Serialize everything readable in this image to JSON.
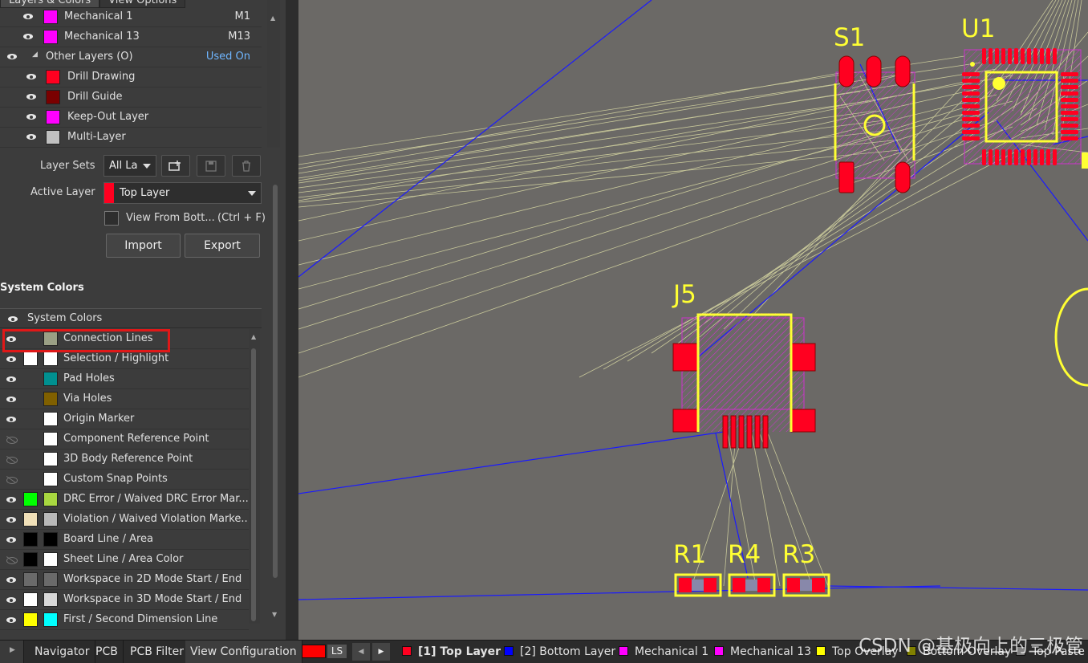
{
  "panel": {
    "tabs": [
      "Layers & Colors",
      "View Options"
    ],
    "layers": [
      {
        "name": "Mechanical 1",
        "short": "M1",
        "color": "#ff00ff"
      },
      {
        "name": "Mechanical 13",
        "short": "M13",
        "color": "#ff00ff"
      }
    ],
    "other_layers": {
      "label": "Other Layers (O)",
      "used_on": "Used On"
    },
    "other_items": [
      {
        "name": "Drill Drawing",
        "color": "#ff0020"
      },
      {
        "name": "Drill Guide",
        "color": "#7a0000"
      },
      {
        "name": "Keep-Out Layer",
        "color": "#ff00ff"
      },
      {
        "name": "Multi-Layer",
        "color": "#c0c0c0"
      }
    ],
    "layer_sets_label": "Layer Sets",
    "layer_sets_value": "All La",
    "active_layer_label": "Active Layer",
    "active_layer_value": "Top Layer",
    "view_from_bottom": "View From Bott...",
    "view_from_bottom_shortcut": "(Ctrl + F)",
    "import_label": "Import",
    "export_label": "Export"
  },
  "system_colors": {
    "section_title": "System Colors",
    "header_label": "System Colors",
    "rows": [
      {
        "name": "Connection Lines",
        "visible": true,
        "show_sel": false,
        "sel_color": "",
        "color": "#9ba085"
      },
      {
        "name": "Selection / Highlight",
        "visible": true,
        "show_sel": true,
        "sel_color": "#ffffff",
        "color": "#ffffff"
      },
      {
        "name": "Pad Holes",
        "visible": true,
        "show_sel": false,
        "sel_color": "",
        "color": "#009090"
      },
      {
        "name": "Via Holes",
        "visible": true,
        "show_sel": false,
        "sel_color": "",
        "color": "#806000"
      },
      {
        "name": "Origin Marker",
        "visible": true,
        "show_sel": false,
        "sel_color": "",
        "color": "#ffffff"
      },
      {
        "name": "Component Reference Point",
        "visible": false,
        "show_sel": false,
        "sel_color": "",
        "color": "#ffffff"
      },
      {
        "name": "3D Body Reference Point",
        "visible": false,
        "show_sel": false,
        "sel_color": "",
        "color": "#ffffff"
      },
      {
        "name": "Custom Snap Points",
        "visible": false,
        "show_sel": false,
        "sel_color": "",
        "color": "#ffffff"
      },
      {
        "name": "DRC Error / Waived DRC Error Mar...",
        "visible": true,
        "show_sel": true,
        "sel_color": "#00ff00",
        "color": "#a8d840"
      },
      {
        "name": "Violation / Waived Violation Marke...",
        "visible": true,
        "show_sel": true,
        "sel_color": "#f0e0b8",
        "color": "#b8b8b8"
      },
      {
        "name": "Board Line / Area",
        "visible": true,
        "show_sel": true,
        "sel_color": "#000000",
        "color": "#000000"
      },
      {
        "name": "Sheet Line / Area Color",
        "visible": false,
        "show_sel": true,
        "sel_color": "#000000",
        "color": "#ffffff"
      },
      {
        "name": "Workspace in 2D Mode Start / End",
        "visible": true,
        "show_sel": true,
        "sel_color": "#6a6a6a",
        "color": "#6a6a6a"
      },
      {
        "name": "Workspace in 3D Mode Start / End",
        "visible": true,
        "show_sel": true,
        "sel_color": "#ffffff",
        "color": "#d8d8d8"
      },
      {
        "name": "First / Second Dimension Line",
        "visible": true,
        "show_sel": true,
        "sel_color": "#ffff00",
        "color": "#00ffff"
      }
    ]
  },
  "pcb": {
    "designators": [
      "S1",
      "U1",
      "J5",
      "R1",
      "R4",
      "R3"
    ],
    "colors": {
      "background": "#6b6966",
      "pad": "#ff0020",
      "overlay": "#ffff33",
      "mech": "#cc33cc",
      "connection": "#b8b890",
      "trace_blue": "#1a1aff"
    }
  },
  "bottom_bar": {
    "panel_tabs": [
      "Navigator",
      "PCB",
      "PCB Filter",
      "View Configuration"
    ],
    "ls_label": "LS",
    "layer_tabs": [
      {
        "label": "[1] Top Layer",
        "color": "#ff0020",
        "bold": true
      },
      {
        "label": "[2] Bottom Layer",
        "color": "#0000ff",
        "bold": false
      },
      {
        "label": "Mechanical 1",
        "color": "#ff00ff",
        "bold": false
      },
      {
        "label": "Mechanical 13",
        "color": "#ff00ff",
        "bold": false
      },
      {
        "label": "Top Overlay",
        "color": "#ffff00",
        "bold": false
      },
      {
        "label": "Bottom Overlay",
        "color": "#808000",
        "bold": false
      },
      {
        "label": "Top Paste",
        "color": "#808080",
        "bold": false
      }
    ],
    "watermark": "CSDN @基极向上的三极管"
  }
}
